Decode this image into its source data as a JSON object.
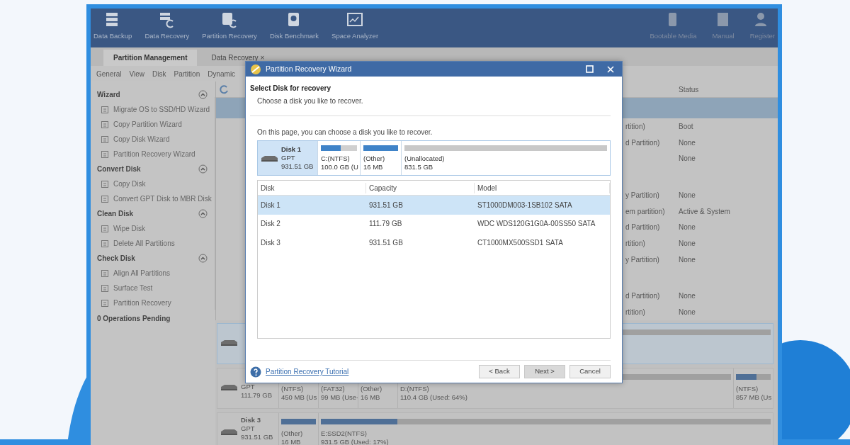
{
  "toolbar": {
    "left": [
      "Data Backup",
      "Data Recovery",
      "Partition Recovery",
      "Disk Benchmark",
      "Space Analyzer"
    ],
    "right": [
      "Bootable Media",
      "Manual",
      "Register"
    ]
  },
  "tabs": [
    {
      "label": "Partition Management",
      "selected": true
    },
    {
      "label": "Data Recovery",
      "selected": false,
      "close": "×"
    }
  ],
  "menu": [
    "General",
    "View",
    "Disk",
    "Partition",
    "Dynamic"
  ],
  "sidebar": {
    "sections": [
      {
        "title": "Wizard",
        "expanded": true,
        "items": [
          "Migrate OS to SSD/HD Wizard",
          "Copy Partition Wizard",
          "Copy Disk Wizard",
          "Partition Recovery Wizard"
        ]
      },
      {
        "title": "Convert Disk",
        "expanded": true,
        "items": [
          "Copy Disk",
          "Convert GPT Disk to MBR Disk"
        ]
      },
      {
        "title": "Clean Disk",
        "expanded": true,
        "items": [
          "Wipe Disk",
          "Delete All Partitions"
        ]
      },
      {
        "title": "Check Disk",
        "expanded": true,
        "items": [
          "Align All Partitions",
          "Surface Test",
          "Partition Recovery"
        ]
      }
    ],
    "pending": "0 Operations Pending"
  },
  "partition_list": {
    "status_heading": "Status",
    "rows": [
      {
        "kind": "disk",
        "selected": true
      },
      {
        "kind": "partition",
        "type": "rtition)",
        "status": "Boot"
      },
      {
        "kind": "partition",
        "type": "d Partition)",
        "status": "None"
      },
      {
        "kind": "partition",
        "type": "",
        "status": "None"
      },
      {
        "kind": "disk",
        "selected": false
      },
      {
        "kind": "partition",
        "type": "y Partition)",
        "status": "None"
      },
      {
        "kind": "partition",
        "type": "em partition)",
        "status": "Active & System"
      },
      {
        "kind": "partition",
        "type": "d Partition)",
        "status": "None"
      },
      {
        "kind": "partition",
        "type": "rtition)",
        "status": "None"
      },
      {
        "kind": "partition",
        "type": "y Partition)",
        "status": "None"
      },
      {
        "kind": "disk",
        "selected": false
      },
      {
        "kind": "partition",
        "type": "d Partition)",
        "status": "None"
      },
      {
        "kind": "partition",
        "type": "rtition)",
        "status": "None"
      }
    ]
  },
  "disk_map": [
    {
      "selected": true,
      "partitions": [
        {
          "grow": true,
          "bar": true
        }
      ]
    },
    {
      "selected": false,
      "lines": [
        "GPT",
        "111.79 GB"
      ],
      "partitions": [
        {
          "lines": [
            "(NTFS)",
            "450 MB (Us"
          ]
        },
        {
          "lines": [
            "(FAT32)",
            "99 MB (Use-"
          ]
        },
        {
          "lines": [
            "(Other)",
            "16 MB"
          ]
        },
        {
          "grow": true,
          "bar": true,
          "lines": [
            "D:(NTFS)",
            "110.4 GB (Used: 64%)"
          ]
        },
        {
          "level": 0.6,
          "lines": [
            "(NTFS)",
            "857 MB (Us"
          ]
        }
      ]
    },
    {
      "selected": false,
      "lines": [
        "Disk 3",
        "GPT",
        "931.51 GB"
      ],
      "partitions": [
        {
          "level": 1,
          "lines": [
            "(Other)",
            "16 MB"
          ]
        },
        {
          "grow": true,
          "level": 0.17,
          "lines": [
            "E:SSD2(NTFS)",
            "931.5 GB (Used: 17%)"
          ]
        }
      ]
    }
  ],
  "dialog": {
    "title": "Partition Recovery Wizard",
    "heading": "Select Disk for recovery",
    "subheading": "Choose a disk you like to recover.",
    "instruction": "On this page, you can choose a disk you like to recover.",
    "disk": {
      "name": "Disk 1",
      "style": "GPT",
      "size": "931.51 GB",
      "partitions": [
        {
          "kind": "used",
          "level": 0.55,
          "label": "C:(NTFS)",
          "size": "100.0 GB (U"
        },
        {
          "kind": "used",
          "level": 1,
          "label": "(Other)",
          "size": "16 MB"
        },
        {
          "kind": "unallocated",
          "label": "(Unallocated)",
          "size": "831.5 GB"
        }
      ]
    },
    "columns": [
      "Disk",
      "Capacity",
      "Model"
    ],
    "rows": [
      {
        "cells": [
          "Disk 1",
          "931.51 GB",
          "ST1000DM003-1SB102 SATA"
        ],
        "selected": true
      },
      {
        "cells": [
          "Disk 2",
          "111.79 GB",
          "WDC WDS120G1G0A-00SS50 SATA"
        ],
        "selected": false
      },
      {
        "cells": [
          "Disk 3",
          "931.51 GB",
          "CT1000MX500SSD1 SATA"
        ],
        "selected": false
      }
    ],
    "help_link": "Partition Recovery Tutorial",
    "buttons": [
      {
        "label": "< Back",
        "default": false
      },
      {
        "label": "Next >",
        "default": true
      },
      {
        "label": "Cancel",
        "default": false
      }
    ]
  }
}
